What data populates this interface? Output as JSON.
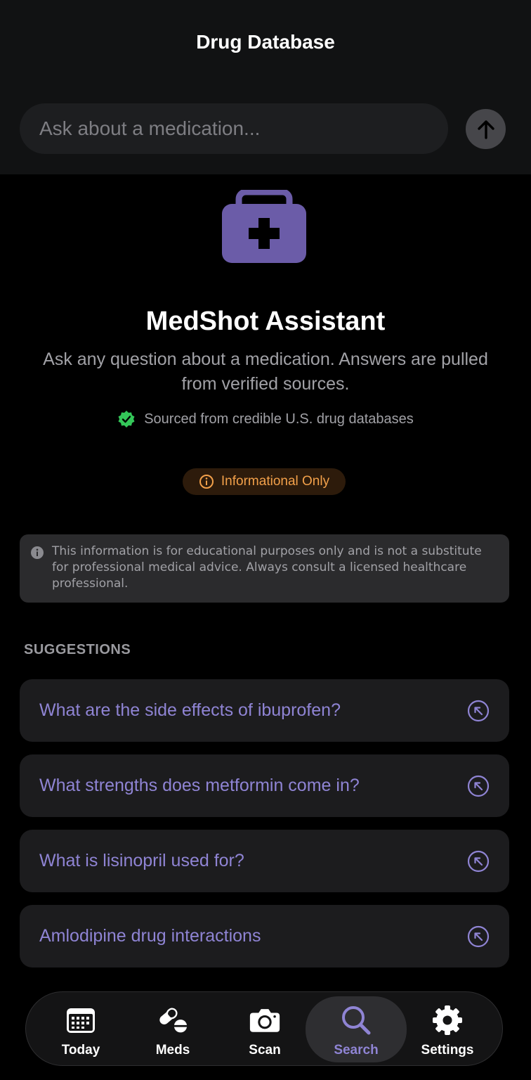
{
  "header": {
    "title": "Drug Database"
  },
  "search": {
    "placeholder": "Ask about a medication...",
    "value": ""
  },
  "assistant": {
    "title": "MedShot Assistant",
    "description": "Ask any question about a medication. Answers are pulled from verified sources.",
    "verified_text": "Sourced from credible U.S. drug databases"
  },
  "badge": {
    "label": "Informational Only"
  },
  "disclaimer": {
    "text": "This information is for educational purposes only and is not a substitute for professional medical advice. Always consult a licensed healthcare professional."
  },
  "suggestions": {
    "label": "SUGGESTIONS",
    "items": [
      {
        "text": "What are the side effects of ibuprofen?"
      },
      {
        "text": "What strengths does metformin come in?"
      },
      {
        "text": "What is lisinopril used for?"
      },
      {
        "text": "Amlodipine drug interactions"
      }
    ]
  },
  "tabs": [
    {
      "label": "Today",
      "icon": "calendar-icon"
    },
    {
      "label": "Meds",
      "icon": "pills-icon"
    },
    {
      "label": "Scan",
      "icon": "camera-icon"
    },
    {
      "label": "Search",
      "icon": "search-icon",
      "active": true
    },
    {
      "label": "Settings",
      "icon": "gear-icon"
    }
  ],
  "colors": {
    "accent": "#8f84d4",
    "kit": "#6b5ca8",
    "verified": "#34c759",
    "badge_text": "#f2a04a",
    "background": "#000000"
  }
}
